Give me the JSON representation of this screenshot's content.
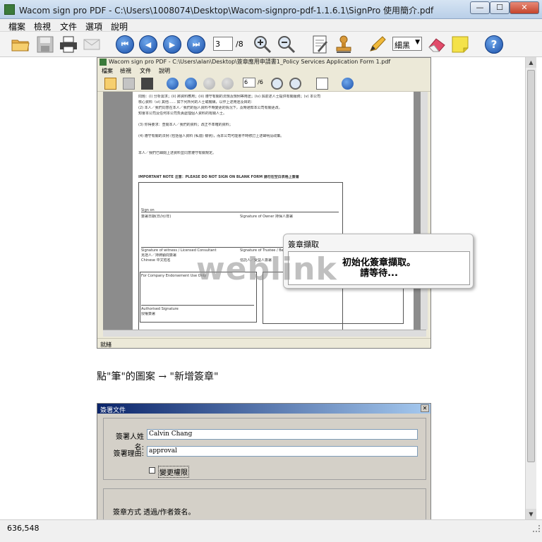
{
  "window": {
    "title": "Wacom sign pro PDF - C:\\Users\\1008074\\Desktop\\Wacom-signpro-pdf-1.1.6.1\\SignPro 使用簡介.pdf",
    "min_glyph": "—",
    "max_glyph": "☐",
    "close_glyph": "✕"
  },
  "menu": [
    "檔案",
    "檢視",
    "文件",
    "選項",
    "說明"
  ],
  "toolbar": {
    "open_icon": "folder-open-icon",
    "save_icon": "save-icon",
    "print_icon": "printer-icon",
    "email_icon": "envelope-icon",
    "first_glyph": "⏮",
    "prev_glyph": "◀",
    "next_glyph": "▶",
    "last_glyph": "⏭",
    "page_current": "3",
    "page_total": "/8",
    "zoom_in_glyph": "+",
    "zoom_out_glyph": "−",
    "stroke_value": "細黑",
    "help_glyph": "?"
  },
  "inner_app": {
    "title": "Wacom sign pro PDF - C:\\Users\\alan\\Desktop\\簽章應用申請書1_Policy Services Application Form 1.pdf",
    "menu": [
      "檔案",
      "檢視",
      "文件",
      "說明"
    ],
    "page_current": "6",
    "page_total": "/6",
    "status": "就緒",
    "doc_lines": [
      "問題：(i) 分析需求；(ii) 將資料應用；(iii) 遵守有關的法規及規例等用途；(iv) 與前述人士提供有關服務；(v) 本公司",
      "核心資料（vi) 其他…… 如下列所列的人士或機構，以作上述用途及目的：",
      "(2) 本人／我們同意在本人／我們的個人資料不時變更的情況下，及時通知本公司有關更改。",
      "知會本公司及任何本公司負責處理個人資料的有關人士。",
      "(3) 你得要求：查閱本人／我們的資料；改正不準確的資料；",
      "(4) 遵守有關的法例 (包括個人資料 (私隱) 條例)，而本公司可能會不時修訂上述聲明及政策。",
      "本人／我們已細閱上述資料並同意遵守有關規定。"
    ],
    "important_note": "IMPORTANT NOTE 注意：PLEASE DO NOT SIGN ON BLANK FORM 請勿在空白表格上簽署",
    "sign_on": "Sign on",
    "date_label": "簽署日期(日/月/年)",
    "owner_sig": "Signature of Owner 持保人簽署",
    "witness_sig": "Signature of witness / Licensed Consultant",
    "witness_sig_cn": "見證人／持牌顧問簽署",
    "chinese_name": "Chinese 中文姓名",
    "trustee_sig": "Signature of Trustee / Beneficiary",
    "trustee_sig_cn": "信託人／受益人簽署",
    "company_use": "For Company Endorsement Use Only",
    "auth_sig": "Authorised Signature",
    "auth_sig_cn": "授權簽署"
  },
  "popup": {
    "title": "簽章擷取",
    "line1": "初始化簽章擷取。",
    "line2": "請等待..."
  },
  "watermark": "weblink",
  "caption": "點\"筆\"的圖案 → \"新增簽章\"",
  "sign_dialog": {
    "title": "簽署文件",
    "close_glyph": "✕",
    "name_label": "簽署人姓名:",
    "name_value": "Calvin Chang",
    "reason_label": "簽署理由:",
    "reason_value": "approval",
    "change_perm_label": "變更權限",
    "method_label": "簽章方式 透過/作者簽名。"
  },
  "status": {
    "coords": "636,548"
  }
}
